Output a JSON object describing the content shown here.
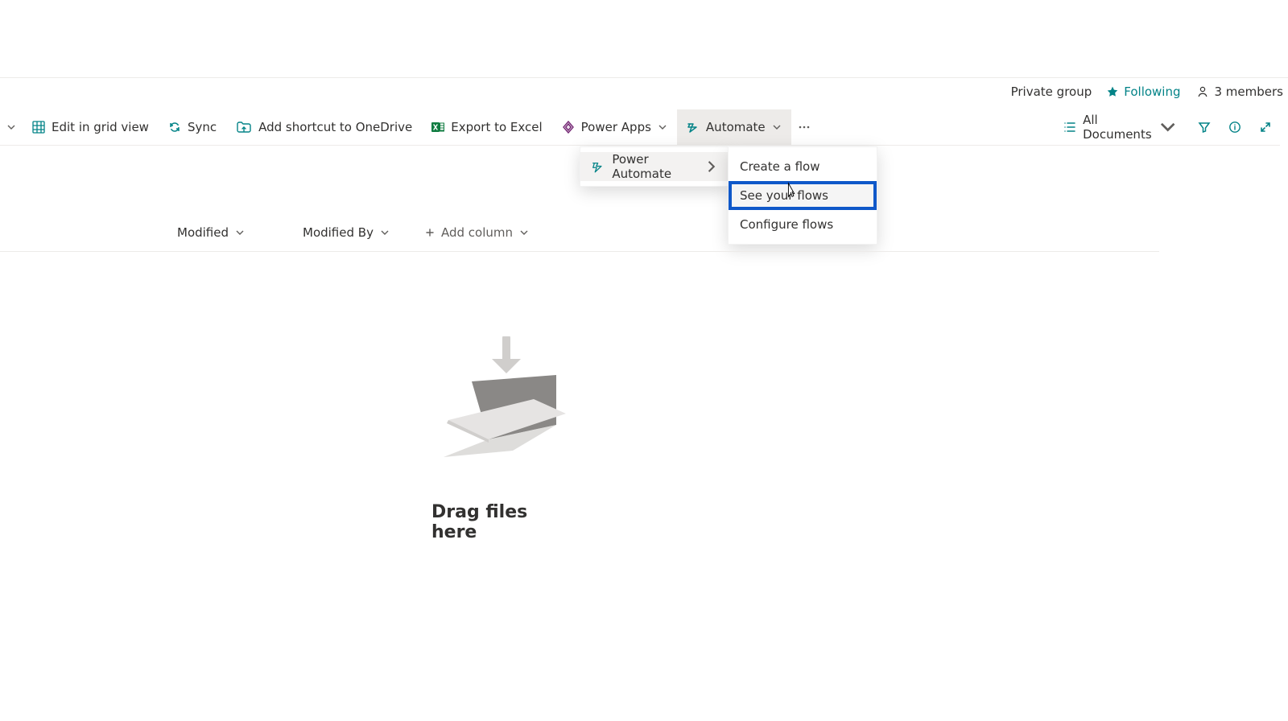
{
  "siteinfo": {
    "group_type": "Private group",
    "following_label": "Following",
    "members_count": "3 members"
  },
  "toolbar": {
    "edit_grid": "Edit in grid view",
    "sync": "Sync",
    "add_shortcut": "Add shortcut to OneDrive",
    "export_excel": "Export to Excel",
    "power_apps": "Power Apps",
    "automate": "Automate",
    "view_selector": "All Documents"
  },
  "automate_menu": {
    "power_automate": "Power Automate"
  },
  "automate_submenu": {
    "create_flow": "Create a flow",
    "see_flows": "See your flows",
    "configure_flows": "Configure flows"
  },
  "columns": {
    "modified": "Modified",
    "modified_by": "Modified By",
    "add": "Add column"
  },
  "empty": {
    "caption": "Drag files here"
  }
}
